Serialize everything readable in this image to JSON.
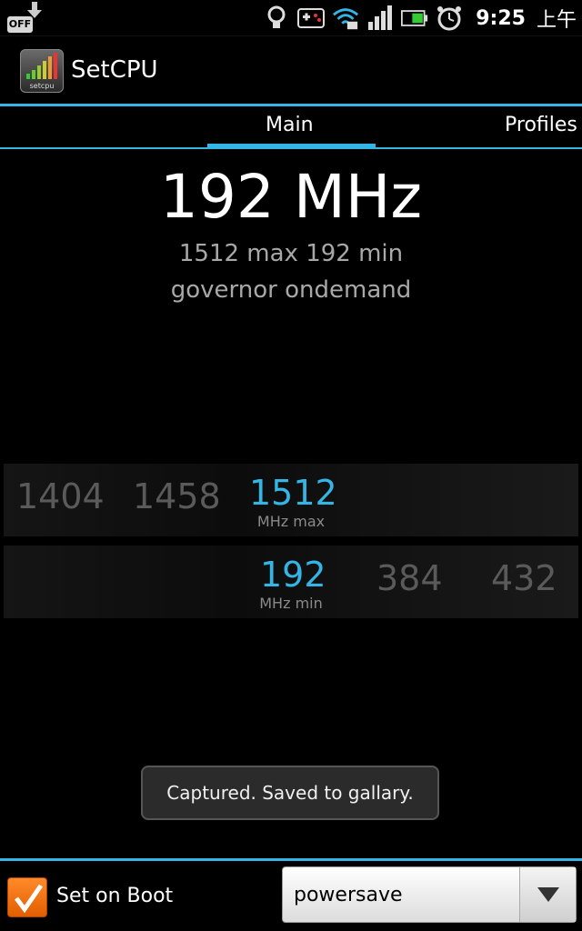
{
  "status_bar": {
    "off_label": "OFF",
    "time": "9:25",
    "ampm": "上午",
    "icons": [
      "download-arrow-icon",
      "lightbulb-icon",
      "gamepad-icon",
      "wifi-icon",
      "signal-icon",
      "battery-icon",
      "alarm-clock-icon"
    ]
  },
  "app": {
    "icon_label": "setcpu",
    "title": "SetCPU"
  },
  "tabs": {
    "main": "Main",
    "profiles": "Profiles"
  },
  "readout": {
    "frequency": "192 MHz",
    "limits": "1512 max 192 min",
    "governor": "governor ondemand"
  },
  "picker_max": {
    "values": [
      "1404",
      "1458",
      "1512"
    ],
    "selected": "1512",
    "unit": "MHz max"
  },
  "picker_min": {
    "values": [
      "192",
      "384",
      "432"
    ],
    "selected": "192",
    "unit": "MHz min"
  },
  "toast": {
    "message": "Captured. Saved to gallary."
  },
  "bottom": {
    "set_on_boot_label": "Set on Boot",
    "set_on_boot_checked": true,
    "governor_select_value": "powersave"
  },
  "colors": {
    "accent": "#33b5e5",
    "checkbox": "#f07010"
  }
}
